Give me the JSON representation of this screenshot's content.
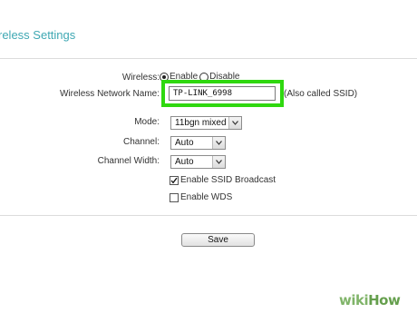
{
  "header": {
    "title": "reless Settings"
  },
  "form": {
    "wireless": {
      "label": "Wireless:",
      "enable_label": "Enable",
      "disable_label": "Disable",
      "selected": "Enable"
    },
    "ssid": {
      "label": "Wireless Network Name:",
      "value": "TP-LINK_6998",
      "note": "(Also called SSID)",
      "highlight_color": "#2fd80f"
    },
    "mode": {
      "label": "Mode:",
      "value": "11bgn mixed"
    },
    "channel": {
      "label": "Channel:",
      "value": "Auto"
    },
    "channel_width": {
      "label": "Channel Width:",
      "value": "Auto"
    },
    "ssid_broadcast": {
      "label": "Enable SSID Broadcast",
      "checked": true
    },
    "wds": {
      "label": "Enable WDS",
      "checked": false
    }
  },
  "actions": {
    "save_label": "Save"
  },
  "watermark": {
    "wiki": "wiki",
    "how": "How"
  },
  "colors": {
    "title": "#3fa8b3",
    "highlight": "#2fd80f",
    "watermark": "#6aa84f"
  },
  "icons": {
    "dropdown": "chevron-down-icon",
    "check": "checkmark-icon"
  }
}
